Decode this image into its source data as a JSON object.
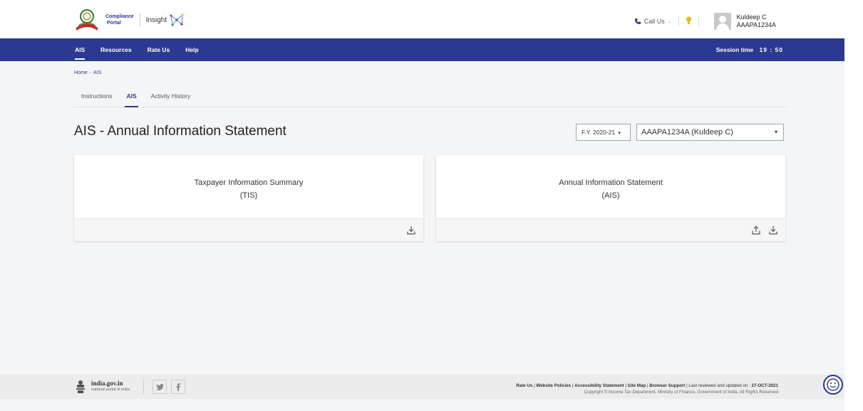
{
  "header": {
    "brand_line1": "Compliance",
    "brand_line2": "Portal",
    "insight": "Insight",
    "call_us": "Call Us",
    "user_name": "Kuldeep C",
    "user_pan": "AAAPA1234A"
  },
  "nav": {
    "items": [
      {
        "label": "AIS",
        "active": true
      },
      {
        "label": "Resources"
      },
      {
        "label": "Rate Us"
      },
      {
        "label": "Help"
      }
    ],
    "session_label": "Session time",
    "session_time": "19 : 50"
  },
  "breadcrumb": {
    "home": "Home",
    "separator": "›",
    "current": "AIS"
  },
  "tabs": [
    {
      "label": "Instructions"
    },
    {
      "label": "AIS",
      "active": true
    },
    {
      "label": "Activity History"
    }
  ],
  "page_title": "AIS - Annual Information Statement",
  "filters": {
    "fy": "F.Y. 2020-21",
    "pan_select": "AAAPA1234A (Kuldeep C)"
  },
  "cards": [
    {
      "title": "Taxpayer Information Summary",
      "subtitle": "(TIS)"
    },
    {
      "title": "Annual Information Statement",
      "subtitle": "(AIS)"
    }
  ],
  "footer": {
    "gov_name": "india.gov.in",
    "gov_sub": "national portal of india",
    "links": [
      "Rate Us",
      "Website Policies",
      "Accessibility Statement",
      "Site Map",
      "Browser Support"
    ],
    "reviewed": "Last reviewed and updated on : ",
    "reviewed_date": "27-OCT-2021",
    "copyright": "Copyright © Income Tax Department, Ministry of Finance, Government of India. All Rights Reserved"
  },
  "colors": {
    "primary": "#2b3990",
    "bulb": "#f2b400"
  }
}
